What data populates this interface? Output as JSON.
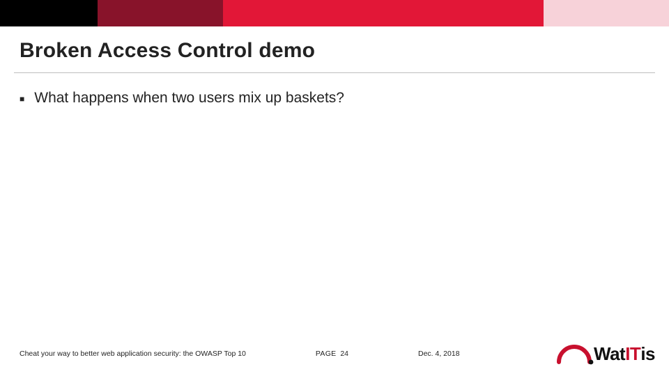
{
  "colors": {
    "barBlack": "#000000",
    "barDarkRed": "#88132a",
    "barRed": "#e21737",
    "barPink": "#f7d2d9",
    "logoRed": "#c8102e"
  },
  "title": "Broken Access Control demo",
  "bullets": [
    "What happens when two users mix up baskets?"
  ],
  "footer": {
    "left": "Cheat your way to better web application security: the OWASP Top 10",
    "pageLabel": "PAGE",
    "pageNumber": "24",
    "date": "Dec. 4, 2018"
  },
  "logo": {
    "prefix": "Wat",
    "accent": "IT",
    "suffix": "is"
  }
}
